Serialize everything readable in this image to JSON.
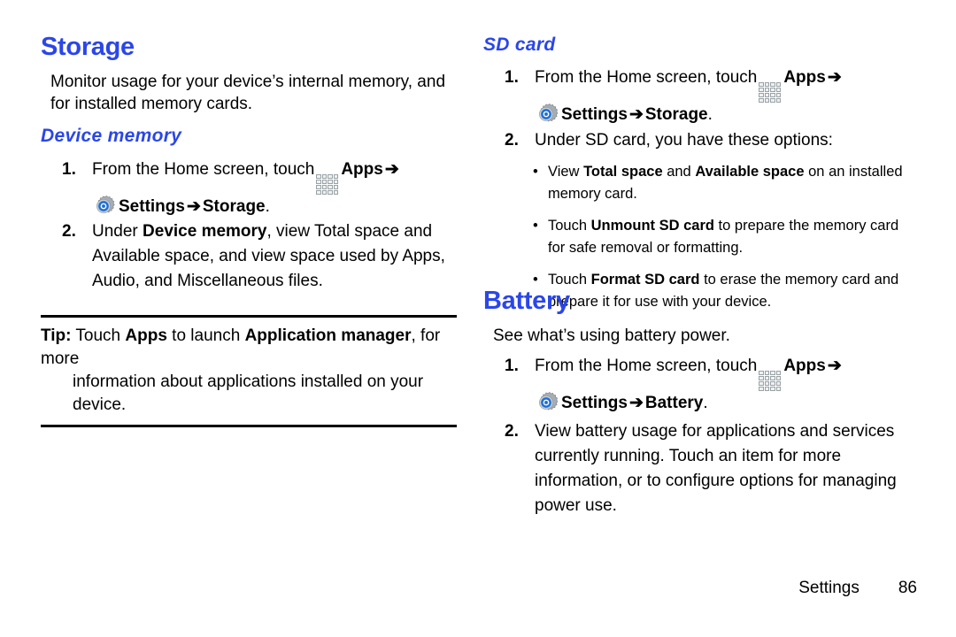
{
  "page": {
    "footer_label": "Settings",
    "footer_page_number": "86",
    "heading_color": "#2b46e8",
    "text_color": "#000000",
    "background_color": "#ffffff"
  },
  "icons": {
    "apps": "apps-grid-icon",
    "settings": "settings-gear-icon",
    "arrow": "➔",
    "bullet": "•"
  },
  "left_column": {
    "storage": {
      "title": "Storage",
      "intro": "Monitor usage for your device’s internal memory, and for installed memory cards.",
      "device_memory": {
        "title": "Device memory",
        "steps": [
          {
            "number": "1.",
            "line1_pre": "From the Home screen, touch",
            "line1_apps_label": "Apps",
            "line2_settings_label": "Settings",
            "line2_target": "Storage",
            "line2_period": "."
          },
          {
            "number": "2.",
            "text_pre": "Under ",
            "text_bold": "Device memory",
            "text_post": ", view Total space and Available space, and view space used by Apps, Audio, and Miscellaneous files."
          }
        ]
      },
      "tip": {
        "label": "Tip:",
        "part1": " Touch ",
        "bold1": "Apps",
        "part2": " to launch ",
        "bold2": "Application manager",
        "part3": ", for more",
        "line2": "information about applications installed on your device."
      }
    }
  },
  "right_column": {
    "sd_card": {
      "title": "SD card",
      "steps": [
        {
          "number": "1.",
          "line1_pre": "From the Home screen, touch",
          "line1_apps_label": "Apps",
          "line2_settings_label": "Settings",
          "line2_target": "Storage",
          "line2_period": "."
        },
        {
          "number": "2.",
          "text": "Under SD card, you have these options:"
        }
      ],
      "options": [
        {
          "pre": "View ",
          "bold1": "Total space",
          "mid": " and ",
          "bold2": "Available space",
          "post": " on an installed memory card."
        },
        {
          "pre": "Touch ",
          "bold1": "Unmount SD card",
          "mid": "",
          "bold2": "",
          "post": " to prepare the memory card for safe removal or formatting."
        },
        {
          "pre": "Touch ",
          "bold1": "Format SD card",
          "mid": "",
          "bold2": "",
          "post": " to erase the memory card and prepare it for use with your device."
        }
      ]
    },
    "battery": {
      "title": "Battery",
      "intro": "See what’s using battery power.",
      "steps": [
        {
          "number": "1.",
          "line1_pre": "From the Home screen, touch",
          "line1_apps_label": "Apps",
          "line2_settings_label": "Settings",
          "line2_target": "Battery",
          "line2_period": "."
        },
        {
          "number": "2.",
          "text": "View battery usage for applications and services currently running. Touch an item for more information, or to configure options for managing power use."
        }
      ]
    }
  }
}
